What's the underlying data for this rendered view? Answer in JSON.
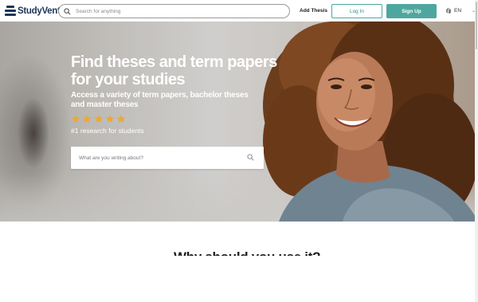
{
  "header": {
    "logo_text": "StudyVent",
    "search_placeholder": "Search for anything",
    "add_thesis_label": "Add Thesis",
    "login_label": "Log In",
    "signup_label": "Sign Up",
    "language": "EN"
  },
  "hero": {
    "title": "Find theses and term papers for your studies",
    "subtitle": "Access a variety of term papers, bachelor theses and master theses",
    "rating_stars": 5,
    "rank_text": "#1 research for students",
    "search_placeholder": "What are you writing about?"
  },
  "section": {
    "title_partial": "Why should you use it?"
  },
  "colors": {
    "brand": "#1d3557",
    "accent": "#4ea79f",
    "star": "#e8a93a"
  },
  "icons": [
    "logo-icon",
    "search-icon",
    "globe-icon",
    "chevron-down-icon",
    "star-icon"
  ]
}
